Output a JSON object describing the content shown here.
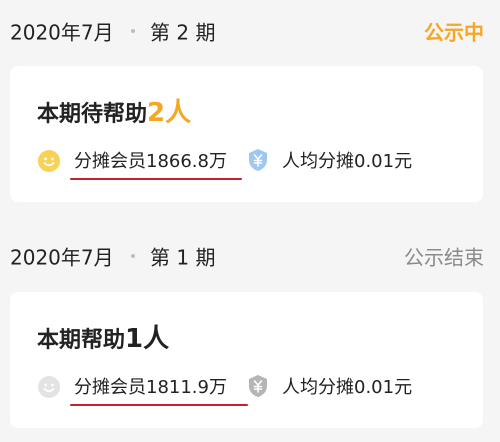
{
  "periods": [
    {
      "date": "2020年7月",
      "period": "第 2 期",
      "status": "公示中",
      "title_prefix": "本期待帮助",
      "count": "2人",
      "members": "分摊会员1866.8万",
      "share": "人均分摊0.01元",
      "colors": {
        "accent": "#f5a623",
        "emoji": "#f7d257",
        "shield": "#9ec8f2",
        "underline": "#c8202a"
      }
    },
    {
      "date": "2020年7月",
      "period": "第 1 期",
      "status": "公示结束",
      "title_prefix": "本期帮助",
      "count": "1人",
      "members": "分摊会员1811.9万",
      "share": "人均分摊0.01元",
      "colors": {
        "accent": "#222222",
        "emoji": "#e3e3e3",
        "shield": "#b5b5b5",
        "underline": "#c8202a"
      }
    }
  ],
  "icons": {
    "emoji": "smiley-icon",
    "shield": "yuan-shield-icon"
  }
}
